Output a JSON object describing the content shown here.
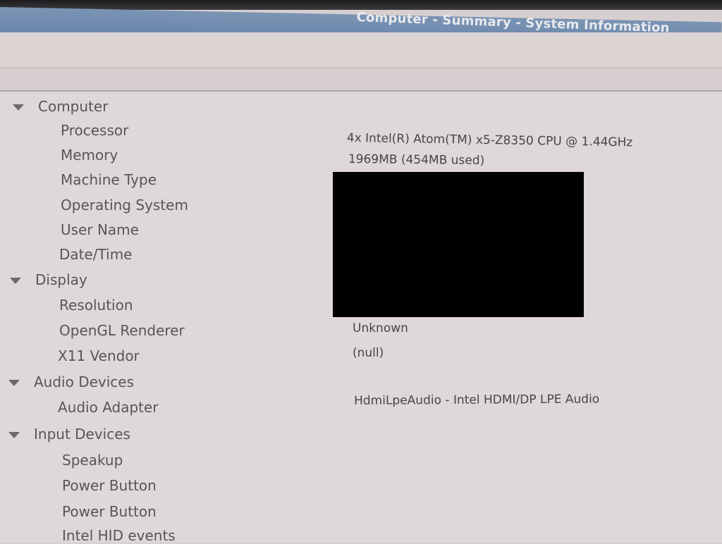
{
  "window": {
    "title": "Computer - Summary - System Information"
  },
  "tree": {
    "computer": {
      "label": "Computer",
      "processor": {
        "label": "Processor",
        "value": "4x Intel(R) Atom(TM) x5-Z8350  CPU @ 1.44GHz"
      },
      "memory": {
        "label": "Memory",
        "value": "1969MB (454MB used)"
      },
      "machine_type": {
        "label": "Machine Type"
      },
      "operating_system": {
        "label": "Operating System"
      },
      "user_name": {
        "label": "User Name"
      },
      "date_time": {
        "label": "Date/Time"
      }
    },
    "display": {
      "label": "Display",
      "resolution": {
        "label": "Resolution"
      },
      "opengl_renderer": {
        "label": "OpenGL Renderer",
        "value": "Unknown"
      },
      "x11_vendor": {
        "label": "X11 Vendor",
        "value": "(null)"
      }
    },
    "audio": {
      "label": "Audio Devices",
      "adapter": {
        "label": "Audio Adapter",
        "value": "HdmiLpeAudio - Intel HDMI/DP LPE Audio"
      }
    },
    "input": {
      "label": "Input Devices",
      "items": [
        "Speakup",
        "Power Button",
        "Power Button",
        "Intel HID events"
      ]
    }
  },
  "icons": {
    "expander": "triangle-down-icon"
  },
  "colors": {
    "titlebar": "#6a86aa",
    "background": "#dfd8d8",
    "redaction": "#000000"
  }
}
